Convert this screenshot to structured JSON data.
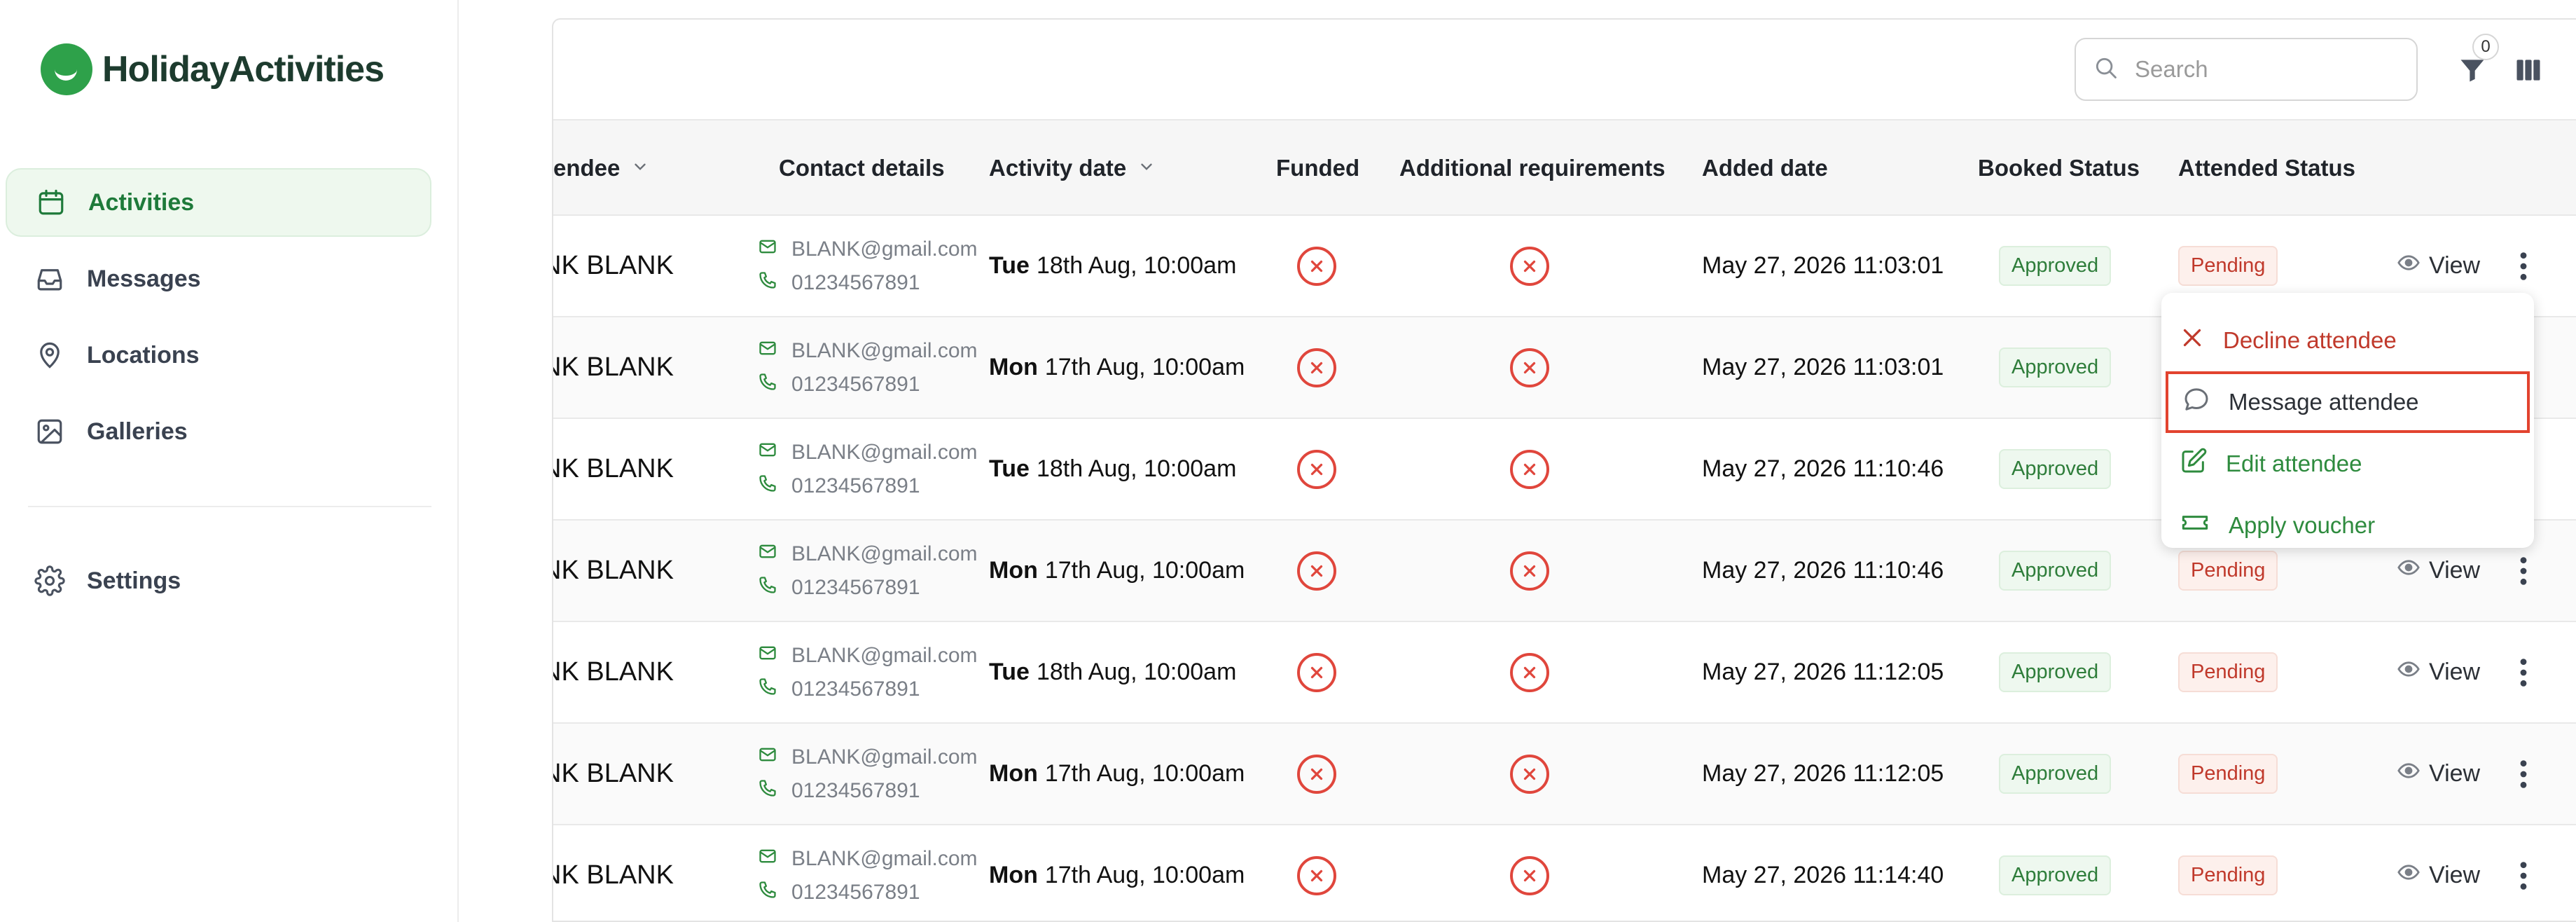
{
  "app": {
    "name": "HolidayActivities",
    "brand_color": "#2ea14a"
  },
  "sidebar": {
    "items": [
      {
        "label": "Activities",
        "icon": "calendar-icon",
        "active": true
      },
      {
        "label": "Messages",
        "icon": "inbox-icon",
        "active": false
      },
      {
        "label": "Locations",
        "icon": "map-pin-icon",
        "active": false
      },
      {
        "label": "Galleries",
        "icon": "image-icon",
        "active": false
      }
    ],
    "settings": {
      "label": "Settings",
      "icon": "gear-icon"
    }
  },
  "toolbar": {
    "search_placeholder": "Search",
    "filter_count": "0"
  },
  "table": {
    "columns": [
      "endee",
      "Contact details",
      "Activity date",
      "Funded",
      "Additional requirements",
      "Added date",
      "Booked Status",
      "Attended Status"
    ],
    "rows": [
      {
        "name": "NK BLANK",
        "email": "BLANK@gmail.com",
        "phone": "01234567891",
        "day": "Tue",
        "date": "18th Aug, 10:00am",
        "added": "May 27, 2026 11:03:01",
        "booked": "Approved",
        "attended": "Pending",
        "view": "View"
      },
      {
        "name": "NK BLANK",
        "email": "BLANK@gmail.com",
        "phone": "01234567891",
        "day": "Mon",
        "date": "17th Aug, 10:00am",
        "added": "May 27, 2026 11:03:01",
        "booked": "Approved",
        "attended": "",
        "view": ""
      },
      {
        "name": "NK BLANK",
        "email": "BLANK@gmail.com",
        "phone": "01234567891",
        "day": "Tue",
        "date": "18th Aug, 10:00am",
        "added": "May 27, 2026 11:10:46",
        "booked": "Approved",
        "attended": "",
        "view": ""
      },
      {
        "name": "NK BLANK",
        "email": "BLANK@gmail.com",
        "phone": "01234567891",
        "day": "Mon",
        "date": "17th Aug, 10:00am",
        "added": "May 27, 2026 11:10:46",
        "booked": "Approved",
        "attended": "Pending",
        "view": "View"
      },
      {
        "name": "NK BLANK",
        "email": "BLANK@gmail.com",
        "phone": "01234567891",
        "day": "Tue",
        "date": "18th Aug, 10:00am",
        "added": "May 27, 2026 11:12:05",
        "booked": "Approved",
        "attended": "Pending",
        "view": "View"
      },
      {
        "name": "NK BLANK",
        "email": "BLANK@gmail.com",
        "phone": "01234567891",
        "day": "Mon",
        "date": "17th Aug, 10:00am",
        "added": "May 27, 2026 11:12:05",
        "booked": "Approved",
        "attended": "Pending",
        "view": "View"
      },
      {
        "name": "NK BLANK",
        "email": "BLANK@gmail.com",
        "phone": "01234567891",
        "day": "Mon",
        "date": "17th Aug, 10:00am",
        "added": "May 27, 2026 11:14:40",
        "booked": "Approved",
        "attended": "Pending",
        "view": "View"
      }
    ]
  },
  "row_menu": {
    "items": [
      {
        "label": "Decline attendee",
        "icon": "close-icon"
      },
      {
        "label": "Message attendee",
        "icon": "chat-bubble-icon",
        "highlighted": true
      },
      {
        "label": "Edit attendee",
        "icon": "edit-icon"
      },
      {
        "label": "Apply voucher",
        "icon": "ticket-icon"
      }
    ]
  },
  "colors": {
    "approved": "#2e7d3a",
    "pending": "#c0392b",
    "unfunded_x": "#e0463c",
    "highlight": "#e2432f"
  }
}
